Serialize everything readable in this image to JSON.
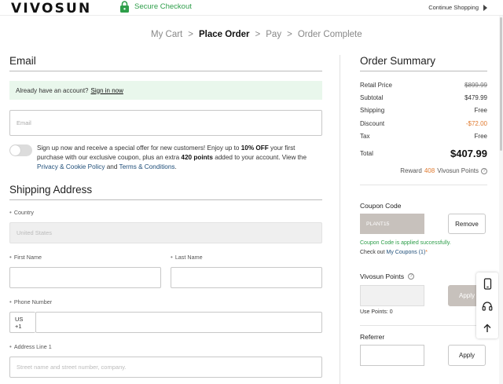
{
  "header": {
    "logo": "VIVOSUN",
    "secure_label": "Secure Checkout",
    "continue_label": "Continue Shopping"
  },
  "steps": [
    "My Cart",
    "Place Order",
    "Pay",
    "Order Complete"
  ],
  "active_step": "Place Order",
  "step_separator": ">",
  "email_section": {
    "title": "Email",
    "banner_text": "Already have an account?",
    "banner_link": "Sign in now",
    "email_placeholder": "Email",
    "promo": {
      "text1": "Sign up now and receive a special offer for new customers! Enjoy up to ",
      "bold1": "10% OFF",
      "text2": " your first purchase with our exclusive coupon, plus an extra ",
      "bold2": "420 points",
      "text3": " added to your account. View the ",
      "link1": "Privacy & Cookie Policy",
      "text4": " and ",
      "link2": "Terms & Conditions",
      "text5": "."
    }
  },
  "shipping": {
    "title": "Shipping Address",
    "country_label": "Country",
    "country_value": "United States",
    "first_name_label": "First Name",
    "last_name_label": "Last Name",
    "phone_label": "Phone Number",
    "phone_code": "US +1",
    "address1_label": "Address Line 1",
    "address1_placeholder": "Street name and street number, company."
  },
  "summary": {
    "title": "Order Summary",
    "rows": [
      {
        "label": "Retail Price",
        "value": "$899.99"
      },
      {
        "label": "Subtotal",
        "value": "$479.99"
      },
      {
        "label": "Shipping",
        "value": "Free"
      },
      {
        "label": "Discount",
        "value": "-$72.00"
      },
      {
        "label": "Tax",
        "value": "Free"
      }
    ],
    "total_label": "Total",
    "total_value": "$407.99",
    "reward_prefix": "Reward",
    "reward_points": "408",
    "reward_suffix": "Vivosun Points"
  },
  "coupon": {
    "title": "Coupon Code",
    "code": "PLANT15",
    "remove_label": "Remove",
    "success": "Coupon Code is applied successfully.",
    "checkout_prefix": "Check out",
    "checkout_link": "My Coupons (1)",
    "dot": "*"
  },
  "points": {
    "title": "Vivosun Points",
    "apply_label": "Apply",
    "use_points": "Use Points: 0"
  },
  "referrer": {
    "title": "Referrer",
    "apply_label": "Apply"
  },
  "colors": {
    "success_green": "#2e9e4a",
    "accent_orange": "#e07a2f",
    "link_blue": "#1f4e79"
  },
  "icons": [
    "lock-icon",
    "triangle-right-icon",
    "info-icon",
    "phone-icon",
    "headset-icon",
    "arrow-up-icon"
  ]
}
